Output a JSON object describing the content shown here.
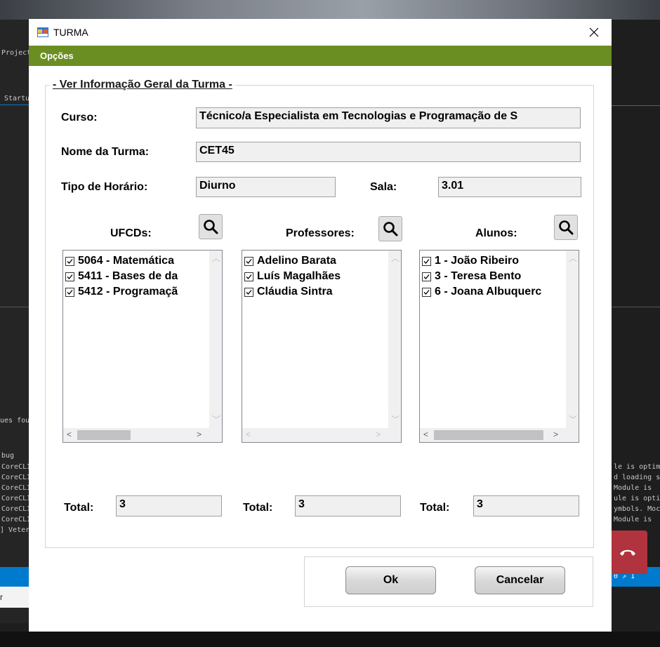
{
  "background": {
    "ide_left_labels": [
      "Project",
      "Startup",
      "ues foun",
      "bug",
      "CoreCLI",
      "CoreCLI",
      "CoreCLI",
      "CoreCLI",
      "CoreCLI",
      "CoreCLI",
      "] Veter",
      "r"
    ],
    "ide_right_labels": [
      "le is optim",
      "d loading s",
      " Module is",
      "ule is opti",
      "ymbols. Moc",
      " Module is",
      "0  ⇗ 1"
    ]
  },
  "dialog": {
    "title": "TURMA",
    "menu": [
      "Opções"
    ],
    "group_title": "- Ver Informação Geral da Turma -",
    "curso": {
      "label": "Curso:",
      "value": "Técnico/a Especialista em Tecnologias e Programação de S"
    },
    "nome_turma": {
      "label": "Nome da Turma:",
      "value": "CET45"
    },
    "tipo_horario": {
      "label": "Tipo de Horário:",
      "value": "Diurno"
    },
    "sala": {
      "label": "Sala:",
      "value": "3.01"
    },
    "ufcds": {
      "label": "UFCDs:",
      "items": [
        "5064 - Matemática",
        "5411 - Bases de da",
        "5412 - Programaçã"
      ],
      "total_label": "Total:",
      "total": "3"
    },
    "professores": {
      "label": "Professores:",
      "items": [
        "Adelino Barata",
        "Luís Magalhães",
        "Cláudia Sintra"
      ],
      "total_label": "Total:",
      "total": "3"
    },
    "alunos": {
      "label": "Alunos:",
      "items": [
        "1 - João Ribeiro",
        "3 - Teresa Bento",
        "6 - Joana Albuquerc"
      ],
      "total_label": "Total:",
      "total": "3"
    },
    "ok_label": "Ok",
    "cancel_label": "Cancelar"
  },
  "colors": {
    "menubar": "#6b8e23",
    "call_button": "#b0333d",
    "status_bar": "#007acc"
  }
}
